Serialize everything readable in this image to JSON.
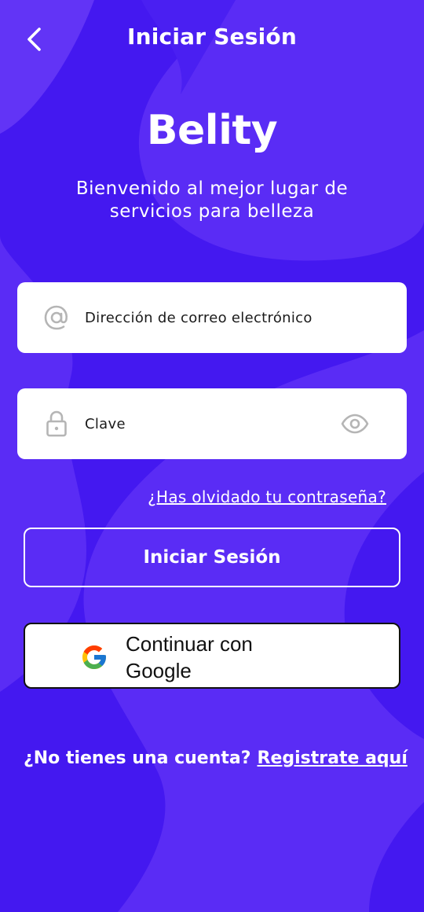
{
  "header": {
    "title": "Iniciar Sesión",
    "back_icon": "chevron-left-icon"
  },
  "brand": {
    "name": "Belity",
    "tagline": "Bienvenido al mejor lugar de servicios para belleza"
  },
  "form": {
    "email": {
      "placeholder": "Dirección de correo electrónico",
      "value": "",
      "icon": "at-sign-icon"
    },
    "password": {
      "placeholder": "Clave",
      "value": "",
      "icon": "lock-icon",
      "toggle_icon": "eye-icon"
    },
    "forgot_link": "¿Has olvidado tu contraseña?",
    "login_label": "Iniciar Sesión",
    "google_label": "Continuar con Google"
  },
  "signup": {
    "prompt": "¿No tienes una cuenta?",
    "link": "Registrate aquí"
  },
  "colors": {
    "background": "#5a2cf5",
    "background_wave": "#4418f0",
    "field_background": "#ffffff",
    "icon_gray": "#b5b5b5"
  }
}
